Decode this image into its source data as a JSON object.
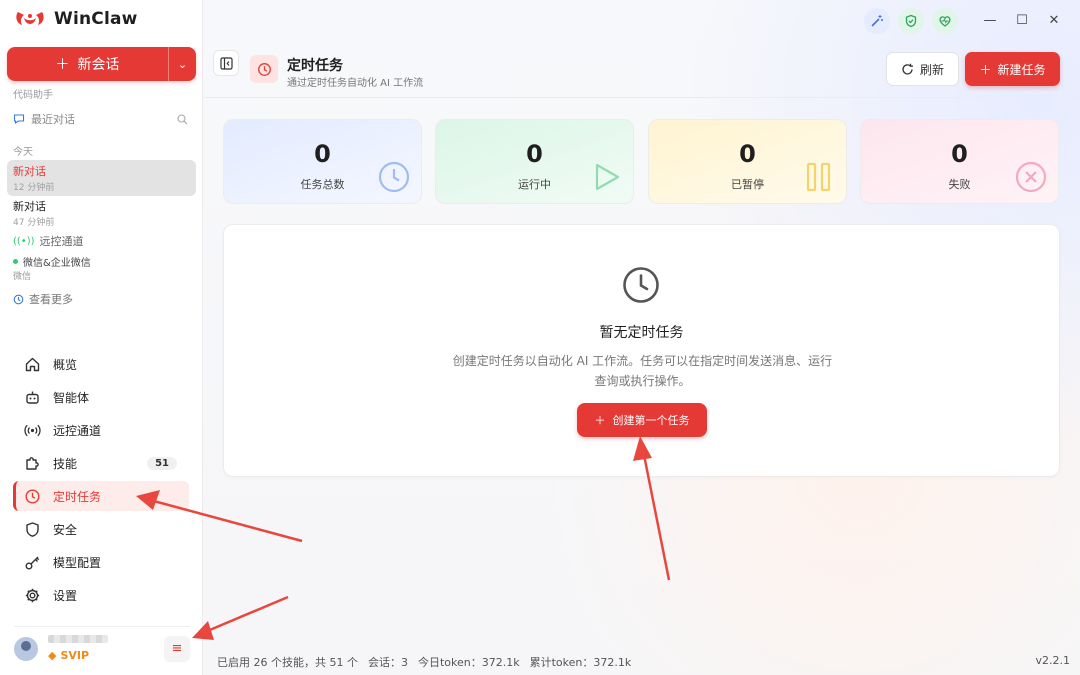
{
  "app": {
    "title": "WinClaw"
  },
  "sidebar": {
    "new_chat_label": "新会话",
    "section_label": "代码助手",
    "recent_label": "最近对话",
    "today_label": "今天",
    "conversations": [
      {
        "title": "新对话",
        "time": "12 分钟前",
        "active": true
      },
      {
        "title": "新对话",
        "time": "47 分钟前",
        "active": false
      }
    ],
    "remote_channel_label": "远控通道",
    "wechat_label": "微信&企业微信",
    "wechat_sub": "微信",
    "view_more_label": "查看更多",
    "nav": [
      {
        "label": "概览",
        "icon": "home-icon"
      },
      {
        "label": "智能体",
        "icon": "robot-icon"
      },
      {
        "label": "远控通道",
        "icon": "broadcast-icon"
      },
      {
        "label": "技能",
        "icon": "puzzle-icon",
        "badge": "51"
      },
      {
        "label": "定时任务",
        "icon": "clock-icon",
        "active": true
      },
      {
        "label": "安全",
        "icon": "shield-icon"
      },
      {
        "label": "模型配置",
        "icon": "key-icon"
      },
      {
        "label": "设置",
        "icon": "gear-icon"
      }
    ],
    "user": {
      "tier": "SVIP"
    }
  },
  "header": {
    "title": "定时任务",
    "subtitle": "通过定时任务自动化 AI 工作流",
    "refresh_label": "刷新",
    "new_task_label": "新建任务"
  },
  "stats": [
    {
      "value": "0",
      "label": "任务总数",
      "icon": "clock-icon"
    },
    {
      "value": "0",
      "label": "运行中",
      "icon": "play-icon"
    },
    {
      "value": "0",
      "label": "已暂停",
      "icon": "pause-icon"
    },
    {
      "value": "0",
      "label": "失败",
      "icon": "x-circle-icon"
    }
  ],
  "empty_state": {
    "title": "暂无定时任务",
    "description": "创建定时任务以自动化 AI 工作流。任务可以在指定时间发送消息、运行查询或执行操作。",
    "button_label": "创建第一个任务"
  },
  "status_bar": {
    "skills": "已启用 26 个技能，共 51 个",
    "sessions": "会话：3",
    "today_token": "今日token：372.1k",
    "total_token": "累计token：372.1k",
    "version": "v2.2.1"
  },
  "colors": {
    "accent": "#e53935",
    "stat_blue": "#eaf0ff",
    "stat_green": "#e6f8ee",
    "stat_yellow": "#fff7de",
    "stat_pink": "#fdebf1"
  }
}
